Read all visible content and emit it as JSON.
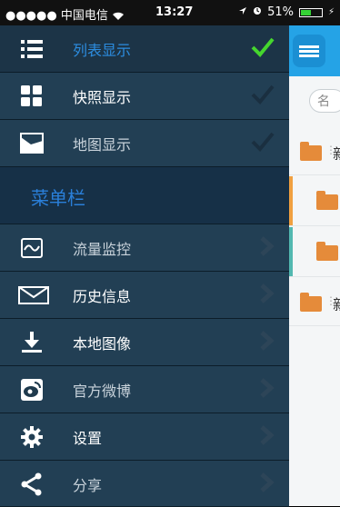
{
  "status_bar": {
    "carrier": "●●●●● 中国电信",
    "time": "13:27",
    "battery_percent": "51%",
    "battery_level": 0.51
  },
  "menu": {
    "view_items": [
      {
        "label": "列表显示",
        "icon": "list-icon",
        "selected": true
      },
      {
        "label": "快照显示",
        "icon": "grid-icon",
        "selected": false
      },
      {
        "label": "地图显示",
        "icon": "map-icon",
        "selected": false
      }
    ],
    "section_title": "菜单栏",
    "nav_items": [
      {
        "label": "流量监控",
        "icon": "chart-icon"
      },
      {
        "label": "历史信息",
        "icon": "mail-icon"
      },
      {
        "label": "本地图像",
        "icon": "download-icon"
      },
      {
        "label": "官方微博",
        "icon": "weibo-icon"
      },
      {
        "label": "设置",
        "icon": "gear-icon"
      },
      {
        "label": "分享",
        "icon": "share-icon"
      }
    ]
  },
  "background_app": {
    "search_placeholder": "名",
    "rows": [
      {
        "text": "新"
      },
      {
        "text": ""
      },
      {
        "text": ""
      },
      {
        "text": "新"
      }
    ]
  },
  "colors": {
    "menu_bg": "#223f54",
    "accent_blue": "#2c8de0",
    "check_green": "#45d62e",
    "topbar_blue": "#25a3e6",
    "folder_orange": "#e58b3a"
  }
}
